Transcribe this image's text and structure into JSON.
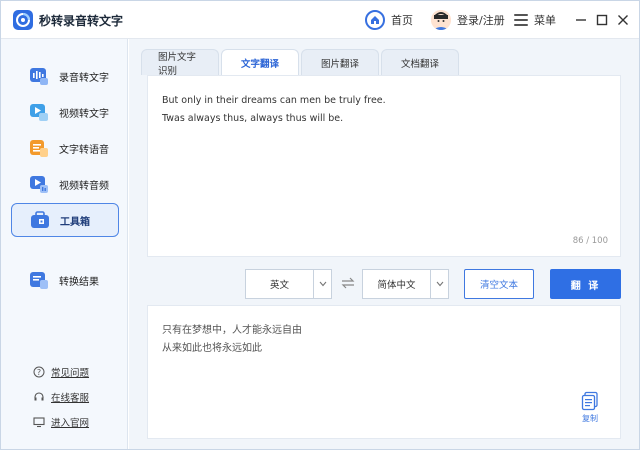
{
  "app": {
    "title": "秒转录音转文字"
  },
  "titlebar": {
    "home": "首页",
    "login": "登录/注册",
    "menu": "菜单"
  },
  "sidebar": {
    "items": [
      {
        "label": "录音转文字",
        "icon": "audio-wave-icon"
      },
      {
        "label": "视频转文字",
        "icon": "video-text-icon"
      },
      {
        "label": "文字转语音",
        "icon": "text-speech-icon"
      },
      {
        "label": "视频转音频",
        "icon": "video-audio-icon"
      },
      {
        "label": "工具箱",
        "icon": "toolbox-icon",
        "active": true
      },
      {
        "label": "转换结果",
        "icon": "result-icon"
      }
    ],
    "links": [
      {
        "label": "常见问题",
        "icon": "question-icon"
      },
      {
        "label": "在线客服",
        "icon": "headset-icon"
      },
      {
        "label": "进入官网",
        "icon": "monitor-icon"
      }
    ]
  },
  "tabs": [
    {
      "label": "图片文字识别"
    },
    {
      "label": "文字翻译",
      "active": true
    },
    {
      "label": "图片翻译"
    },
    {
      "label": "文档翻译"
    }
  ],
  "source": {
    "line1": "But only in their dreams can men be truly free.",
    "line2": "Twas always thus, always thus will be.",
    "counter": "86 / 100"
  },
  "controls": {
    "from_lang": "英文",
    "to_lang": "简体中文",
    "clear_label": "清空文本",
    "translate_label": "翻 译"
  },
  "result": {
    "line1": "只有在梦想中，人才能永远自由",
    "line2": "从来如此也将永远如此",
    "copy_label": "复制"
  },
  "colors": {
    "accent": "#2f6fe4",
    "sidebar_bg": "#f4f8fd"
  }
}
